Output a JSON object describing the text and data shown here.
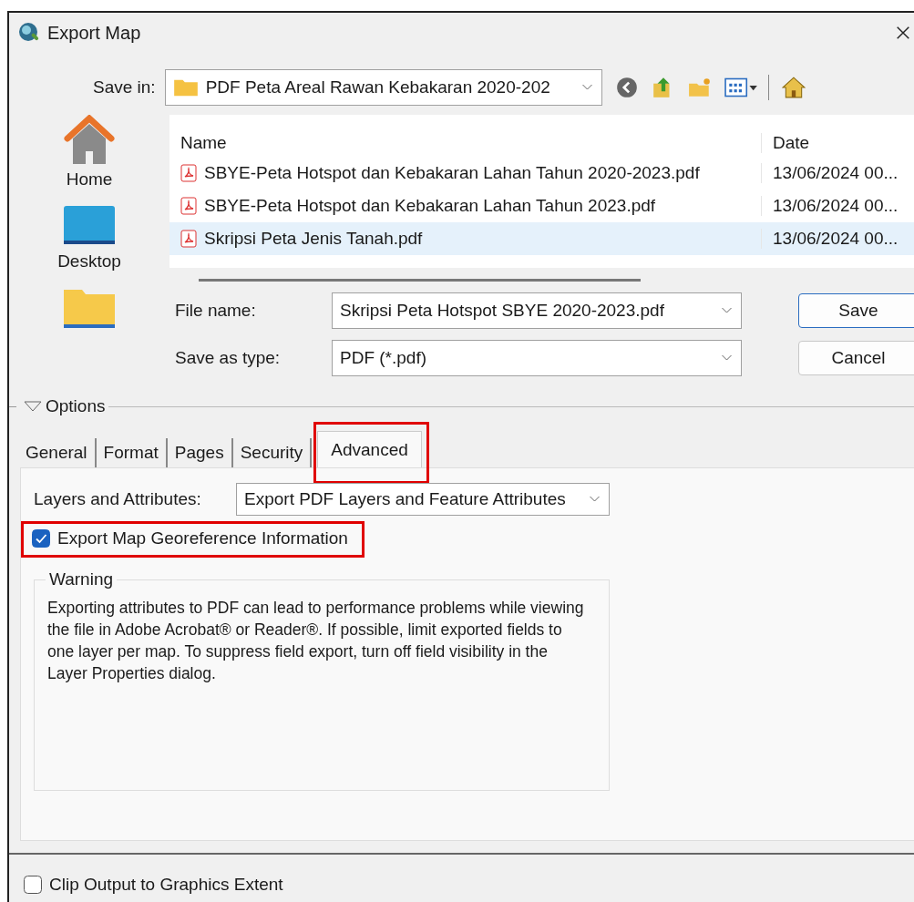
{
  "window": {
    "title": "Export Map"
  },
  "save_in": {
    "label": "Save in:",
    "value": "PDF Peta Areal Rawan Kebakaran 2020-202"
  },
  "places": [
    {
      "kind": "home",
      "label": "Home"
    },
    {
      "kind": "desktop",
      "label": "Desktop"
    },
    {
      "kind": "folder"
    }
  ],
  "file_list": {
    "columns": [
      "Name",
      "Date"
    ],
    "rows": [
      {
        "name": "SBYE-Peta Hotspot dan Kebakaran Lahan Tahun 2020-2023.pdf",
        "date": "13/06/2024 00...",
        "selected": false
      },
      {
        "name": "SBYE-Peta Hotspot dan Kebakaran Lahan Tahun 2023.pdf",
        "date": "13/06/2024 00...",
        "selected": false
      },
      {
        "name": "Skripsi Peta Jenis Tanah.pdf",
        "date": "13/06/2024 00...",
        "selected": true
      }
    ]
  },
  "file_name": {
    "label": "File name:",
    "value": "Skripsi Peta Hotspot SBYE 2020-2023.pdf"
  },
  "save_as_type": {
    "label": "Save as type:",
    "value": "PDF (*.pdf)"
  },
  "buttons": [
    {
      "label": "Save",
      "default": true
    },
    {
      "label": "Cancel",
      "default": false
    }
  ],
  "options": {
    "label": "Options",
    "expanded": true
  },
  "tabs": [
    {
      "label": "General",
      "selected": false,
      "highlighted": false
    },
    {
      "label": "Format",
      "selected": false,
      "highlighted": false
    },
    {
      "label": "Pages",
      "selected": false,
      "highlighted": false
    },
    {
      "label": "Security",
      "selected": false,
      "highlighted": false
    },
    {
      "label": "Advanced",
      "selected": true,
      "highlighted": true
    }
  ],
  "layers_attributes": {
    "label": "Layers and Attributes:",
    "value": "Export PDF Layers and Feature Attributes"
  },
  "georeference": {
    "label": "Export Map Georeference Information",
    "checked": true,
    "highlighted": true
  },
  "warning": {
    "title": "Warning",
    "text": "Exporting attributes to PDF can lead to performance problems while viewing the file in Adobe Acrobat® or Reader®.  If possible, limit exported fields to one layer per map. To suppress field export, turn off field visibility in the Layer Properties dialog."
  },
  "clip_output": {
    "label": "Clip Output to Graphics Extent",
    "checked": false
  }
}
